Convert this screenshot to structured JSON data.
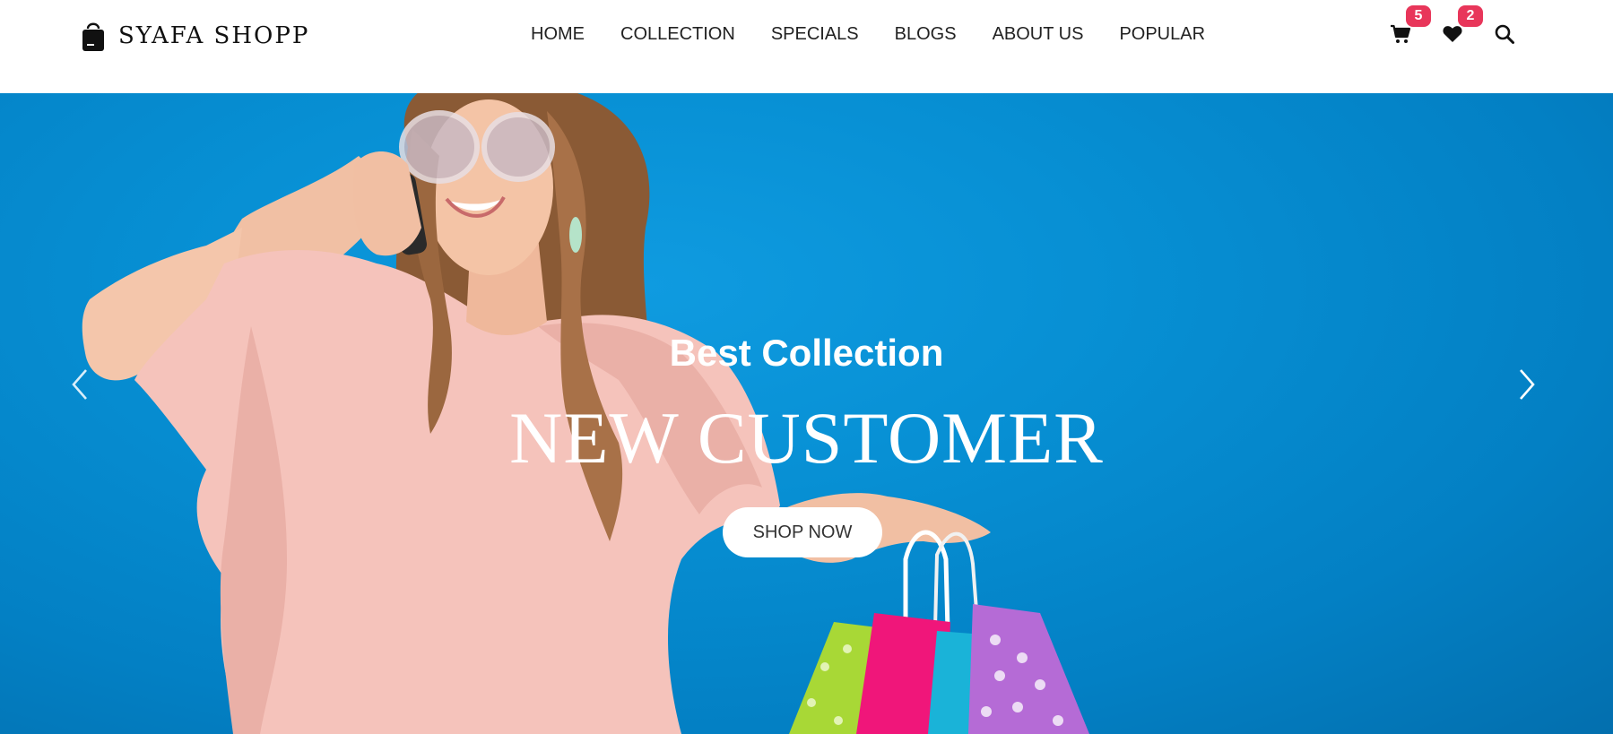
{
  "brand": {
    "name": "SYAFA SHOPP",
    "logo_icon": "shopping-bag-icon"
  },
  "nav": {
    "items": [
      {
        "label": "HOME"
      },
      {
        "label": "COLLECTION"
      },
      {
        "label": "SPECIALS"
      },
      {
        "label": "BLOGS"
      },
      {
        "label": "ABOUT US"
      },
      {
        "label": "POPULAR"
      }
    ]
  },
  "header_icons": {
    "cart": {
      "icon": "cart-icon",
      "count": "5"
    },
    "wishlist": {
      "icon": "heart-icon",
      "count": "2"
    },
    "search": {
      "icon": "search-icon"
    }
  },
  "hero": {
    "subtitle": "Best Collection",
    "title": "NEW CUSTOMER",
    "cta_label": "SHOP NOW",
    "prev_icon": "chevron-left-icon",
    "next_icon": "chevron-right-icon"
  },
  "colors": {
    "hero_background": "#0a8fd4",
    "badge": "#e8365a",
    "text_dark": "#222222"
  }
}
